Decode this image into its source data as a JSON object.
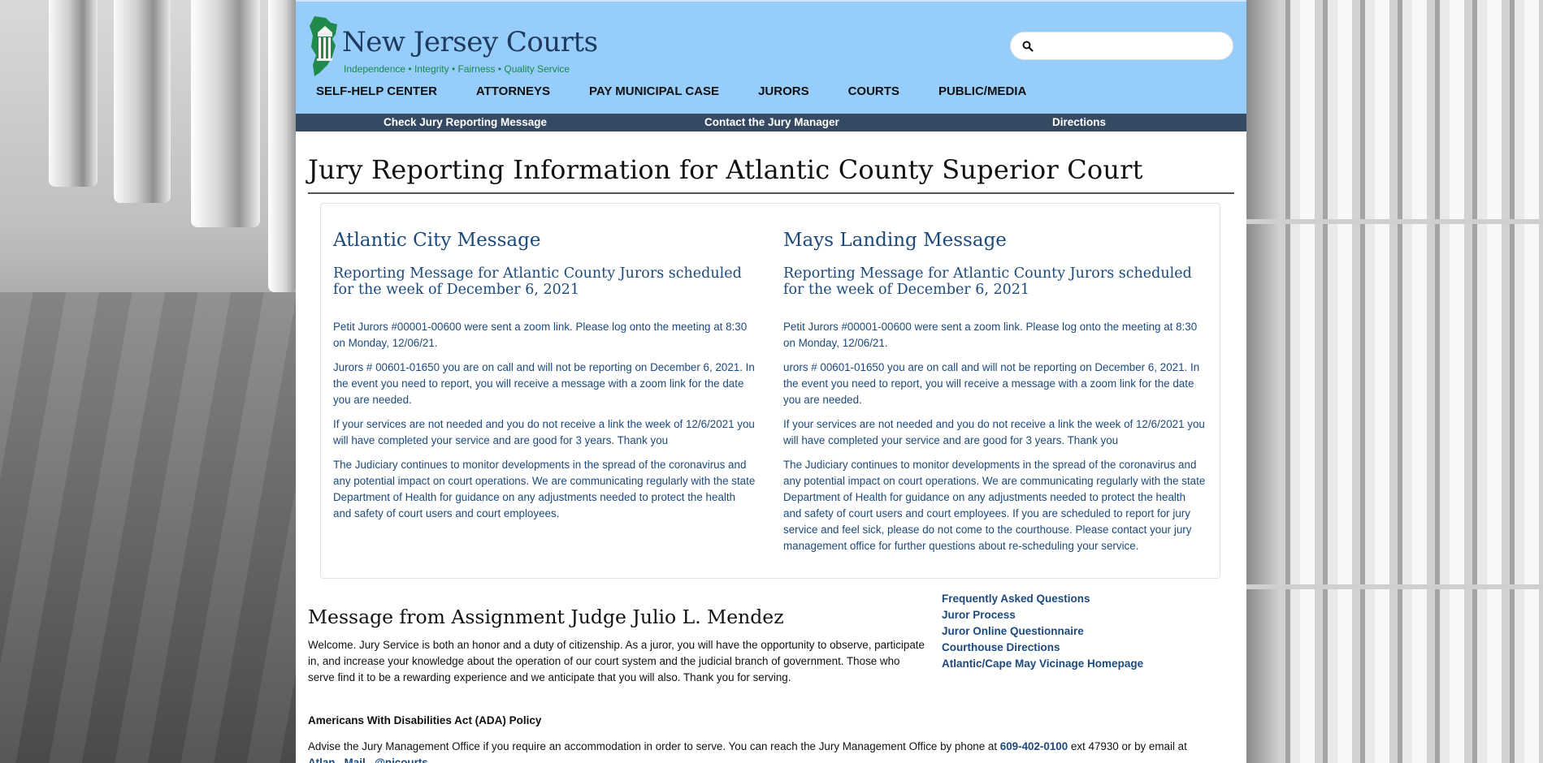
{
  "header": {
    "logo_title": "New Jersey Courts",
    "logo_tagline": "Independence • Integrity • Fairness • Quality Service",
    "search_placeholder": ""
  },
  "nav": [
    {
      "label": "SELF-HELP CENTER"
    },
    {
      "label": "ATTORNEYS"
    },
    {
      "label": "PAY MUNICIPAL CASE"
    },
    {
      "label": "JURORS"
    },
    {
      "label": "COURTS"
    },
    {
      "label": "PUBLIC/MEDIA"
    }
  ],
  "subnav": [
    {
      "label": "Check Jury Reporting Message"
    },
    {
      "label": "Contact the Jury Manager"
    },
    {
      "label": "Directions"
    }
  ],
  "page_title": "Jury Reporting Information for Atlantic County Superior Court",
  "messages": [
    {
      "heading": "Atlantic City Message",
      "subheading": "Reporting Message for Atlantic County Jurors scheduled for the week of December 6, 2021",
      "paragraphs": [
        "Petit Jurors #00001-00600 were sent a zoom link. Please log onto the meeting at 8:30 on Monday, 12/06/21.",
        "Jurors # 00601-01650 you are on call and will not be reporting on December 6, 2021. In the event you need to report, you will receive a message with a zoom link for the date you are needed.",
        "If your services are not needed and you do not receive a link the week of 12/6/2021 you will have completed your service and are good for 3 years. Thank you",
        "The Judiciary continues to monitor developments in the spread of the coronavirus and any potential impact on court operations. We are communicating regularly with the state Department of Health for guidance on any adjustments needed to protect the health and safety of court users and court employees."
      ]
    },
    {
      "heading": "Mays Landing Message",
      "subheading": "Reporting Message for Atlantic County Jurors scheduled for the week of December 6, 2021",
      "paragraphs": [
        "Petit Jurors #00001-00600 were sent a zoom link. Please log onto the meeting at 8:30 on Monday, 12/06/21.",
        "urors # 00601-01650 you are on call and will not be reporting on December 6, 2021. In the event you need to report, you will receive a message with a zoom link for the date you are needed.",
        "If your services are not needed and you do not receive a link the week of 12/6/2021 you will have completed your service and are good for 3 years. Thank you",
        "The Judiciary continues to monitor developments in the spread of the coronavirus and any potential impact on court operations. We are communicating regularly with the state Department of Health for guidance on any adjustments needed to protect the health and safety of court users and court employees. If you are scheduled to report for jury service and feel sick, please do not come to the courthouse. Please contact your jury management office for further questions about re-scheduling your service."
      ]
    }
  ],
  "judge": {
    "heading": "Message from Assignment Judge Julio L. Mendez",
    "welcome": "Welcome. Jury Service is both an honor and a duty of citizenship. As a juror, you will have the opportunity to observe, participate in, and increase your knowledge about the operation of our court system and the judicial branch of government. Those who serve find it to be a rewarding experience and we anticipate that you will also. Thank you for serving."
  },
  "quick_links": [
    {
      "label": "Frequently Asked Questions"
    },
    {
      "label": "Juror Process"
    },
    {
      "label": "Juror Online Questionnaire"
    },
    {
      "label": "Courthouse Directions"
    },
    {
      "label": "Atlantic/Cape May Vicinage Homepage"
    }
  ],
  "ada": {
    "heading": "Americans With Disabilities Act (ADA) Policy",
    "text_before": "Advise the Jury Management Office if you require an accommodation in order to serve. You can reach the Jury Management Office by phone at ",
    "phone": "609-402-0100",
    "text_after": " ext 47930 or by email at",
    "email_fragment": "Atlan...Mail...@njcourts..."
  },
  "colors": {
    "header_bg": "#96cdfb",
    "subnav_bg": "#354a62",
    "link_blue": "#1c4a7c"
  }
}
